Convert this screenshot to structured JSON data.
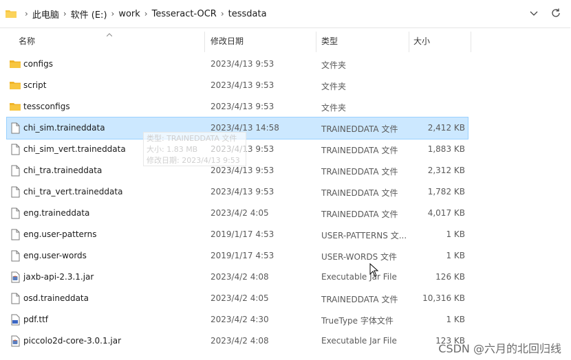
{
  "address_bar": {
    "crumbs": [
      "此电脑",
      "软件 (E:)",
      "work",
      "Tesseract-OCR",
      "tessdata"
    ]
  },
  "columns": {
    "name": "名称",
    "date": "修改日期",
    "type": "类型",
    "size": "大小"
  },
  "files": [
    {
      "name": "configs",
      "date": "2023/4/13 9:53",
      "type": "文件夹",
      "size": "",
      "icon": "folder-icon"
    },
    {
      "name": "script",
      "date": "2023/4/13 9:53",
      "type": "文件夹",
      "size": "",
      "icon": "folder-icon"
    },
    {
      "name": "tessconfigs",
      "date": "2023/4/13 9:53",
      "type": "文件夹",
      "size": "",
      "icon": "folder-icon"
    },
    {
      "name": "chi_sim.traineddata",
      "date": "2023/4/13 14:58",
      "type": "TRAINEDDATA 文件",
      "size": "2,412 KB",
      "icon": "file-icon",
      "selected": true
    },
    {
      "name": "chi_sim_vert.traineddata",
      "date": "2023/4/13 9:53",
      "type": "TRAINEDDATA 文件",
      "size": "1,883 KB",
      "icon": "file-icon"
    },
    {
      "name": "chi_tra.traineddata",
      "date": "2023/4/13 9:53",
      "type": "TRAINEDDATA 文件",
      "size": "2,312 KB",
      "icon": "file-icon"
    },
    {
      "name": "chi_tra_vert.traineddata",
      "date": "2023/4/13 9:53",
      "type": "TRAINEDDATA 文件",
      "size": "1,782 KB",
      "icon": "file-icon"
    },
    {
      "name": "eng.traineddata",
      "date": "2023/4/2 4:05",
      "type": "TRAINEDDATA 文件",
      "size": "4,017 KB",
      "icon": "file-icon"
    },
    {
      "name": "eng.user-patterns",
      "date": "2019/1/17 4:53",
      "type": "USER-PATTERNS 文...",
      "size": "1 KB",
      "icon": "file-icon"
    },
    {
      "name": "eng.user-words",
      "date": "2019/1/17 4:53",
      "type": "USER-WORDS 文件",
      "size": "1 KB",
      "icon": "file-icon"
    },
    {
      "name": "jaxb-api-2.3.1.jar",
      "date": "2023/4/2 4:08",
      "type": "Executable Jar File",
      "size": "126 KB",
      "icon": "jar-icon"
    },
    {
      "name": "osd.traineddata",
      "date": "2023/4/2 4:05",
      "type": "TRAINEDDATA 文件",
      "size": "10,316 KB",
      "icon": "file-icon"
    },
    {
      "name": "pdf.ttf",
      "date": "2023/4/2 4:30",
      "type": "TrueType 字体文件",
      "size": "1 KB",
      "icon": "font-file-icon"
    },
    {
      "name": "piccolo2d-core-3.0.1.jar",
      "date": "2023/4/2 4:08",
      "type": "Executable Jar File",
      "size": "123 KB",
      "icon": "jar-icon"
    }
  ],
  "tooltip": {
    "line1": "类型: TRAINEDDATA 文件",
    "line2": "大小: 1.83 MB",
    "line3": "修改日期: 2023/4/13 9:53"
  },
  "watermark": "CSDN @六月的北回归线",
  "colors": {
    "selected_bg": "#cce8ff",
    "folder": "#f8c640"
  }
}
